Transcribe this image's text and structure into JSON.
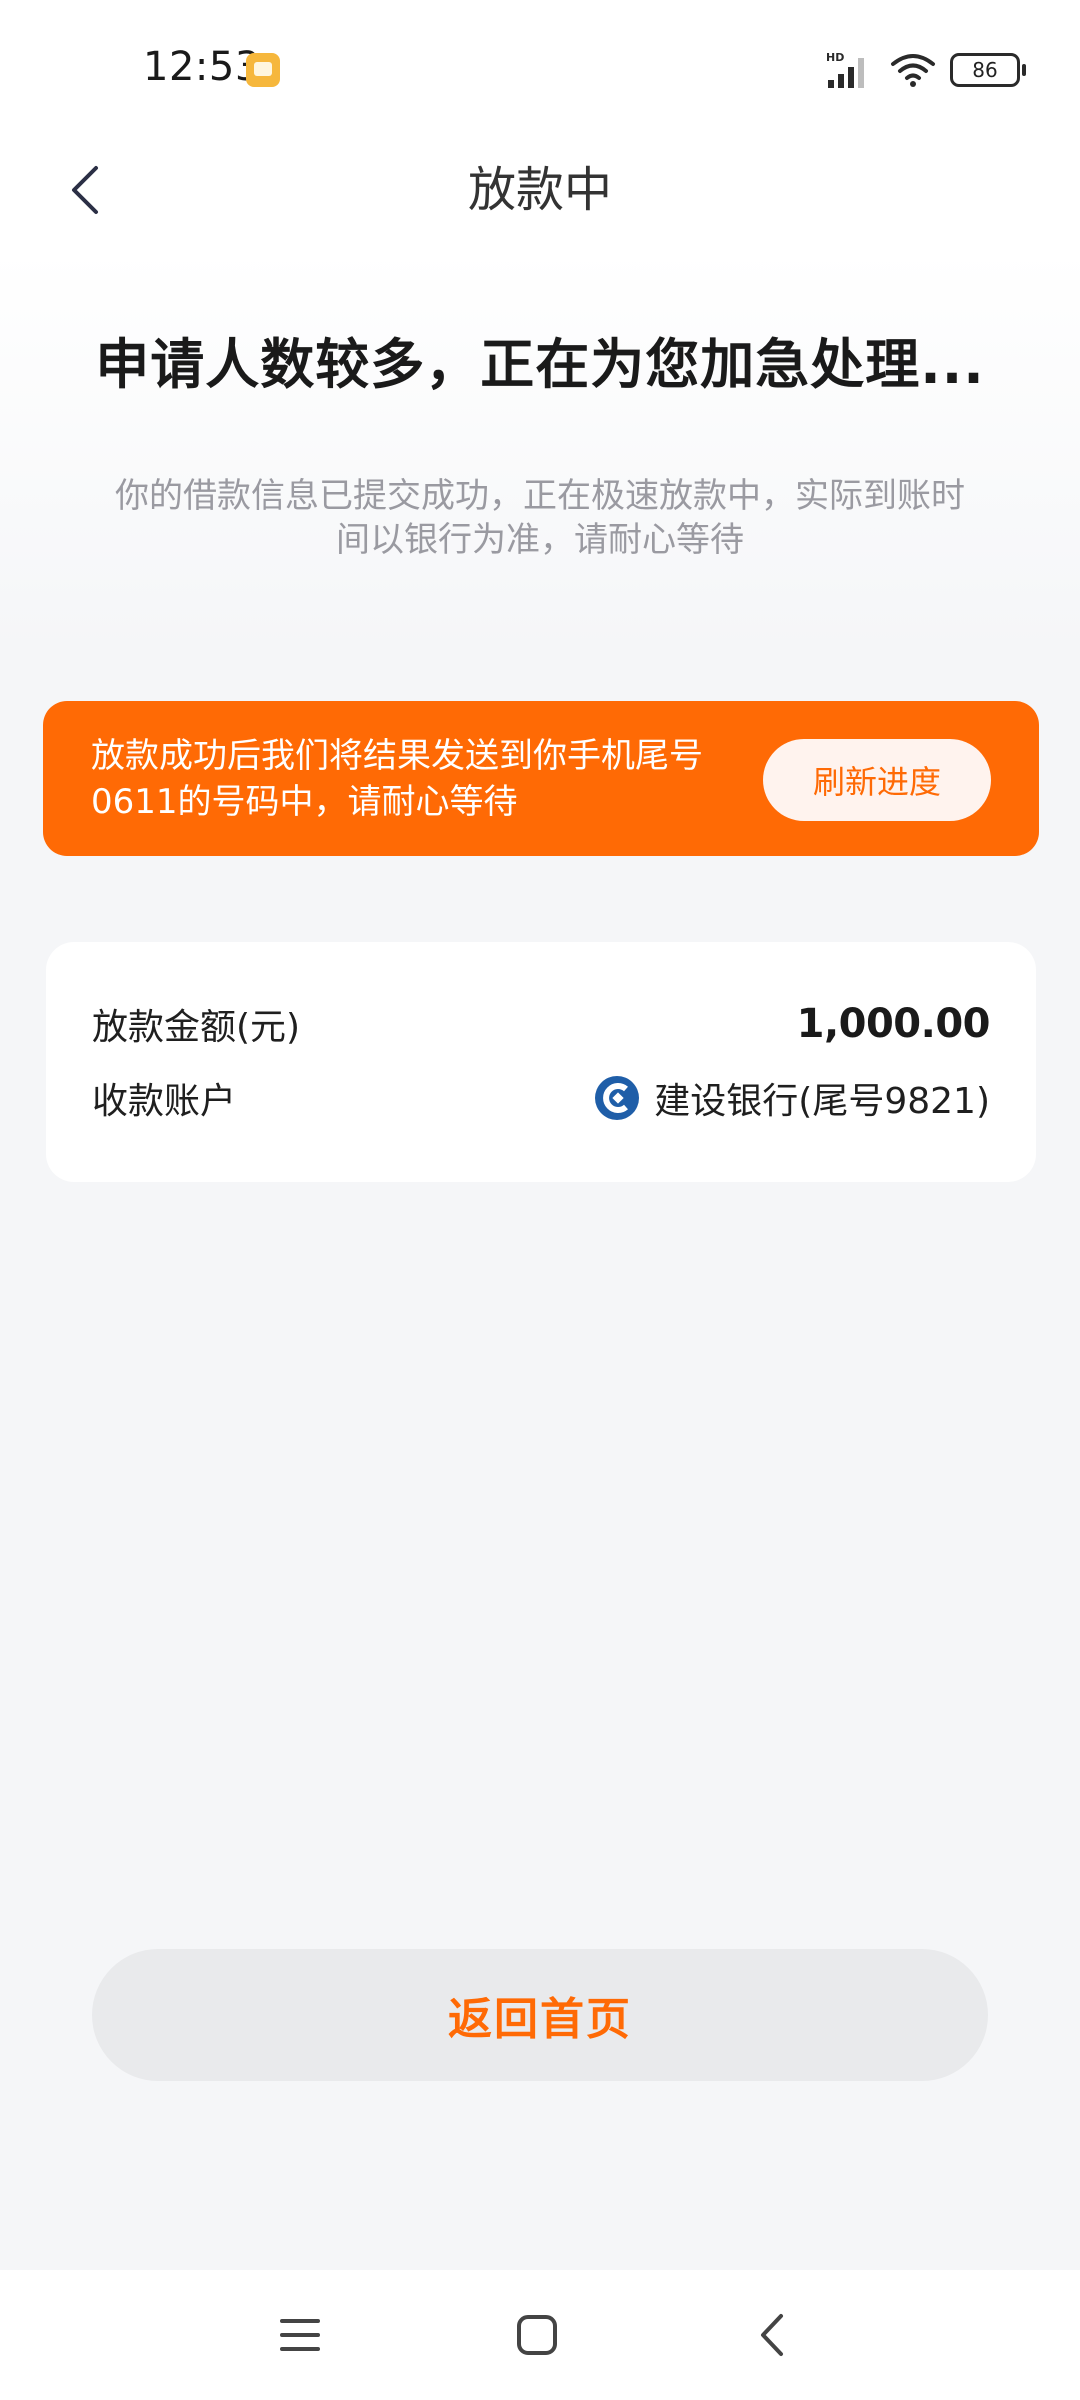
{
  "status_bar": {
    "time": "12:53",
    "signal_label": "HD",
    "battery": "86"
  },
  "header": {
    "title": "放款中",
    "back_icon": "chevron-left-icon"
  },
  "main": {
    "headline": "申请人数较多，正在为您加急处理...",
    "subline": "你的借款信息已提交成功，正在极速放款中，实际到账时间以银行为准，请耐心等待"
  },
  "banner": {
    "text": "放款成功后我们将结果发送到你手机尾号0611的号码中，请耐心等待",
    "refresh_label": "刷新进度",
    "color": "#ff6a05"
  },
  "info": {
    "amount_label": "放款金额(元)",
    "amount_value": "1,000.00",
    "account_label": "收款账户",
    "account_value": "建设银行(尾号9821)",
    "bank_icon": "ccb-bank-icon"
  },
  "actions": {
    "home_label": "返回首页"
  },
  "nav": {
    "menu_icon": "menu-icon",
    "home_icon": "square-home-icon",
    "back_icon": "back-icon"
  }
}
